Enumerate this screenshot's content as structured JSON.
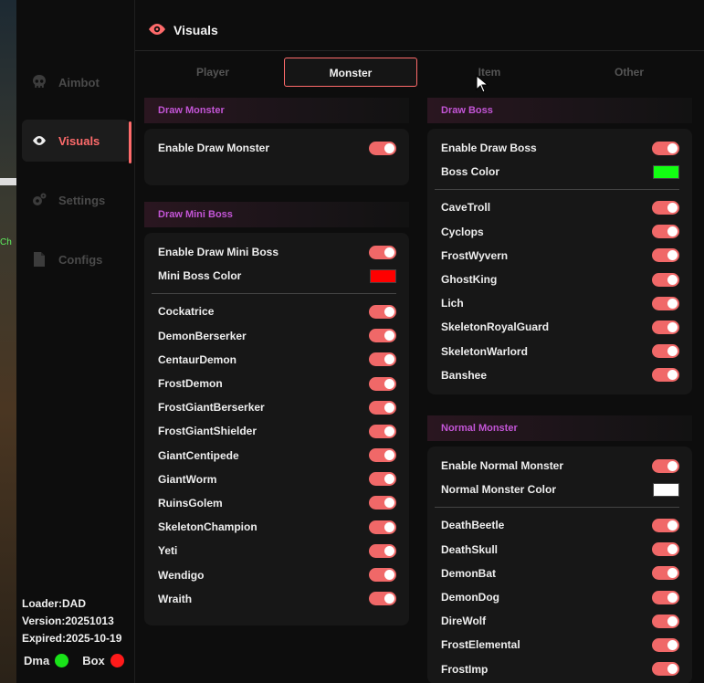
{
  "game_bg": {
    "fragment_text": "Ch"
  },
  "header": {
    "title": "Visuals",
    "icon": "eye-icon",
    "accent": "#ff6b6b"
  },
  "sidebar": {
    "items": [
      {
        "label": "Aimbot",
        "icon": "skull-icon",
        "active": false
      },
      {
        "label": "Visuals",
        "icon": "eye-icon",
        "active": true
      },
      {
        "label": "Settings",
        "icon": "gear-icon",
        "active": false
      },
      {
        "label": "Configs",
        "icon": "file-icon",
        "active": false
      }
    ],
    "info": {
      "loader": "Loader:DAD",
      "version": "Version:20251013",
      "expired": "Expired:2025-10-19"
    },
    "status": {
      "dma_label": "Dma",
      "dma_color": "#19e319",
      "box_label": "Box",
      "box_color": "#ff1a1a"
    }
  },
  "tabs": [
    {
      "label": "Player",
      "active": false
    },
    {
      "label": "Monster",
      "active": true
    },
    {
      "label": "Item",
      "active": false
    },
    {
      "label": "Other",
      "active": false
    }
  ],
  "draw_monster": {
    "title": "Draw Monster",
    "enable_label": "Enable Draw Monster"
  },
  "draw_mini_boss": {
    "title": "Draw Mini Boss",
    "enable_label": "Enable Draw Mini Boss",
    "color_label": "Mini Boss Color",
    "color": "#ff0000",
    "list": [
      "Cockatrice",
      "DemonBerserker",
      "CentaurDemon",
      "FrostDemon",
      "FrostGiantBerserker",
      "FrostGiantShielder",
      "GiantCentipede",
      "GiantWorm",
      "RuinsGolem",
      "SkeletonChampion",
      "Yeti",
      "Wendigo",
      "Wraith"
    ]
  },
  "draw_boss": {
    "title": "Draw Boss",
    "enable_label": "Enable Draw Boss",
    "color_label": "Boss Color",
    "color": "#12ff12",
    "list": [
      "CaveTroll",
      "Cyclops",
      "FrostWyvern",
      "GhostKing",
      "Lich",
      "SkeletonRoyalGuard",
      "SkeletonWarlord",
      "Banshee"
    ]
  },
  "normal_monster": {
    "title": "Normal Monster",
    "enable_label": "Enable Normal Monster",
    "color_label": "Normal Monster Color",
    "color": "#ffffff",
    "list": [
      "DeathBeetle",
      "DeathSkull",
      "DemonBat",
      "DemonDog",
      "DireWolf",
      "FrostElemental",
      "FrostImp"
    ]
  },
  "toggle_color": "#f06868"
}
